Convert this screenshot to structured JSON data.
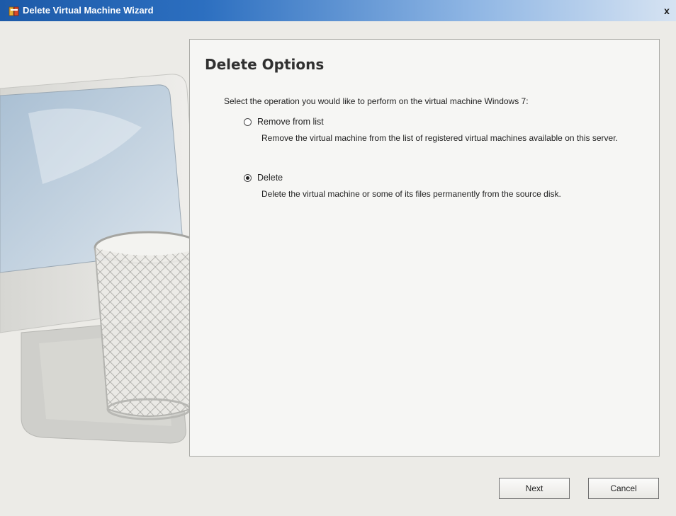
{
  "window": {
    "title": "Delete Virtual Machine Wizard",
    "app_icon": "vmware-icon",
    "close_glyph": "x",
    "close_icon": "close-icon"
  },
  "illustration": {
    "icons": [
      "monitor-icon",
      "trash-bin-icon"
    ]
  },
  "content": {
    "heading": "Delete Options",
    "instruction": "Select the operation you would like to perform on the virtual machine Windows 7:",
    "options": [
      {
        "label": "Remove from list",
        "description": "Remove the virtual machine from the list of registered virtual machines available on this server.",
        "selected": false
      },
      {
        "label": "Delete",
        "description": "Delete the virtual machine or some of its files permanently from the source disk.",
        "selected": true
      }
    ]
  },
  "buttons": {
    "next": "Next",
    "cancel": "Cancel"
  },
  "colors": {
    "titlebar_start": "#1d5aa8",
    "titlebar_end": "#d6e3f2",
    "window_bg": "#ecebe7",
    "panel_bg": "#f6f6f4"
  }
}
